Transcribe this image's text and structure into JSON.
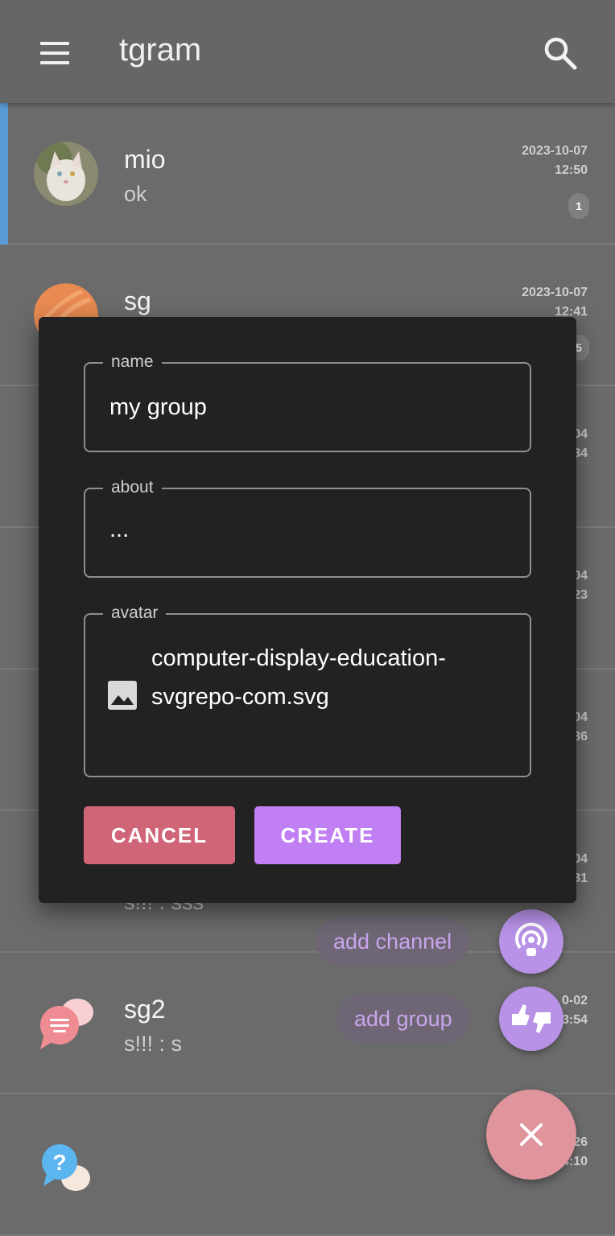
{
  "app": {
    "title": "tgram"
  },
  "chats": [
    {
      "name": "mio",
      "last": "ok",
      "date": "2023-10-07",
      "time": "12:50",
      "unread": "1"
    },
    {
      "name": "sg",
      "last": "",
      "date": "2023-10-07",
      "time": "12:41",
      "unread": "5"
    },
    {
      "name": "",
      "last": "",
      "date": "04",
      "time": "34",
      "unread": ""
    },
    {
      "name": "",
      "last": "",
      "date": "04",
      "time": "23",
      "unread": ""
    },
    {
      "name": "",
      "last": "",
      "date": "04",
      "time": "36",
      "unread": ""
    },
    {
      "name": "",
      "last": "s!!! : sss",
      "date": "04",
      "time": "31",
      "unread": ""
    },
    {
      "name": "sg2",
      "last": "s!!! : s",
      "date": "0-02",
      "time": "3:54",
      "unread": ""
    },
    {
      "name": "",
      "last": "",
      "date": "26",
      "time": "14:10",
      "unread": ""
    }
  ],
  "dialog": {
    "name_label": "name",
    "name_value": "my group",
    "about_label": "about",
    "about_value": "...",
    "avatar_label": "avatar",
    "avatar_file": "computer-display-education-svgrepo-com.svg",
    "cancel_label": "CANCEL",
    "create_label": "CREATE"
  },
  "speed_dial": {
    "add_channel": "add channel",
    "add_group": "add group"
  },
  "colors": {
    "cancel": "#d06577",
    "create": "#c17ff4",
    "fab": "#e0949c",
    "active_bar": "#5b9bd5"
  },
  "icons": [
    "menu-icon",
    "search-icon",
    "image-icon",
    "podcast-icon",
    "thumbs-icon",
    "close-icon"
  ]
}
